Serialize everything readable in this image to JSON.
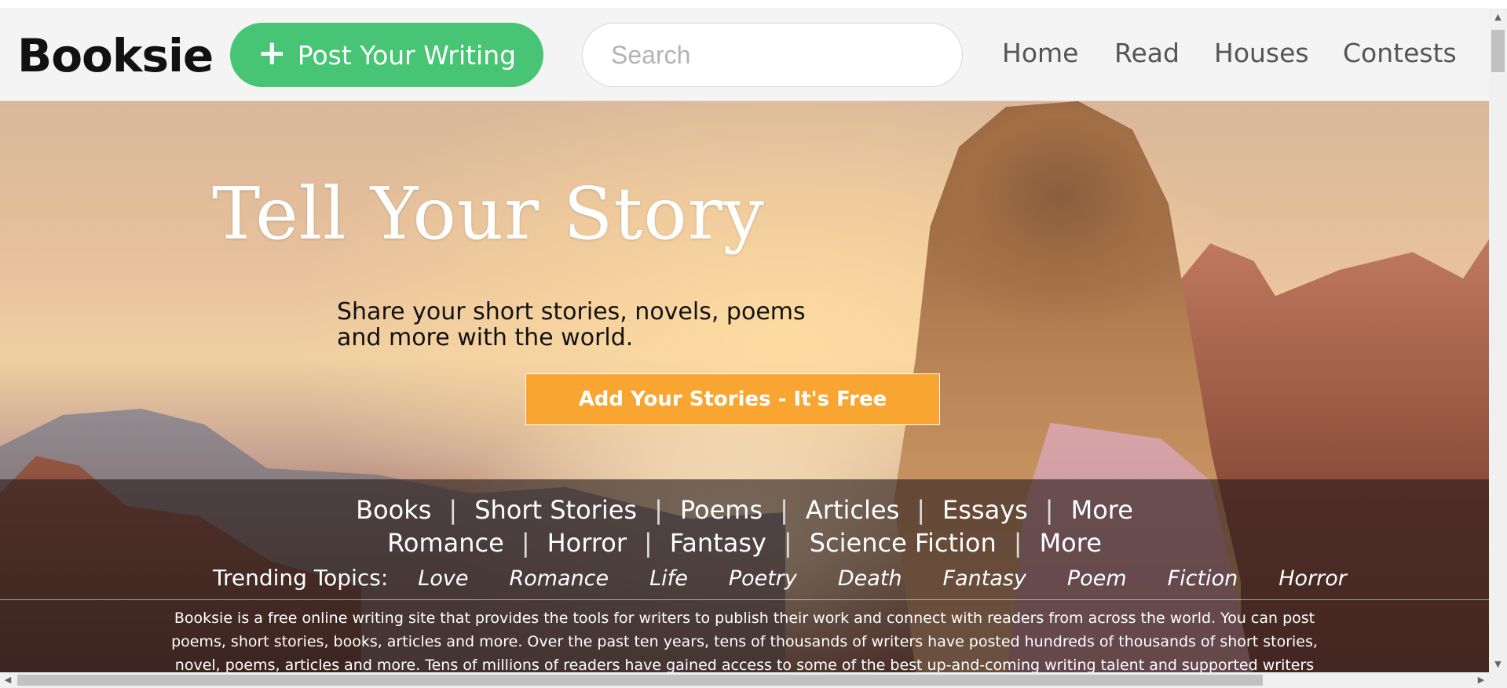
{
  "header": {
    "logo_text": "Booksie",
    "post_button_label": "Post Your Writing",
    "post_button_icon": "plus-icon",
    "search_placeholder": "Search",
    "nav": [
      "Home",
      "Read",
      "Houses",
      "Contests"
    ]
  },
  "hero": {
    "title": "Tell Your Story",
    "subtitle_line1": "Share your short stories, novels, poems",
    "subtitle_line2": "and more with the world.",
    "cta_label": "Add Your Stories - It's Free"
  },
  "categories": {
    "row1": [
      "Books",
      "Short Stories",
      "Poems",
      "Articles",
      "Essays",
      "More"
    ],
    "row2": [
      "Romance",
      "Horror",
      "Fantasy",
      "Science Fiction",
      "More"
    ],
    "separator": "|"
  },
  "trending": {
    "label": "Trending Topics:",
    "topics": [
      "Love",
      "Romance",
      "Life",
      "Poetry",
      "Death",
      "Fantasy",
      "Poem",
      "Fiction",
      "Horror"
    ]
  },
  "about_text": "Booksie is a free online writing site that provides the tools for writers to publish their work and connect with readers from across the world. You can post poems, short stories, books, articles and more. Over the past ten years, tens of thousands of writers have posted hundreds of thousands of short stories, novel, poems, articles and more. Tens of millions of readers have gained access to some of the best up-and-coming writing talent and supported writers who have gone on to become best-sellers. Join Booksie and tell",
  "colors": {
    "post_button": "#47c574",
    "cta_button": "#f8a531",
    "header_bg": "#f4f4f4"
  }
}
